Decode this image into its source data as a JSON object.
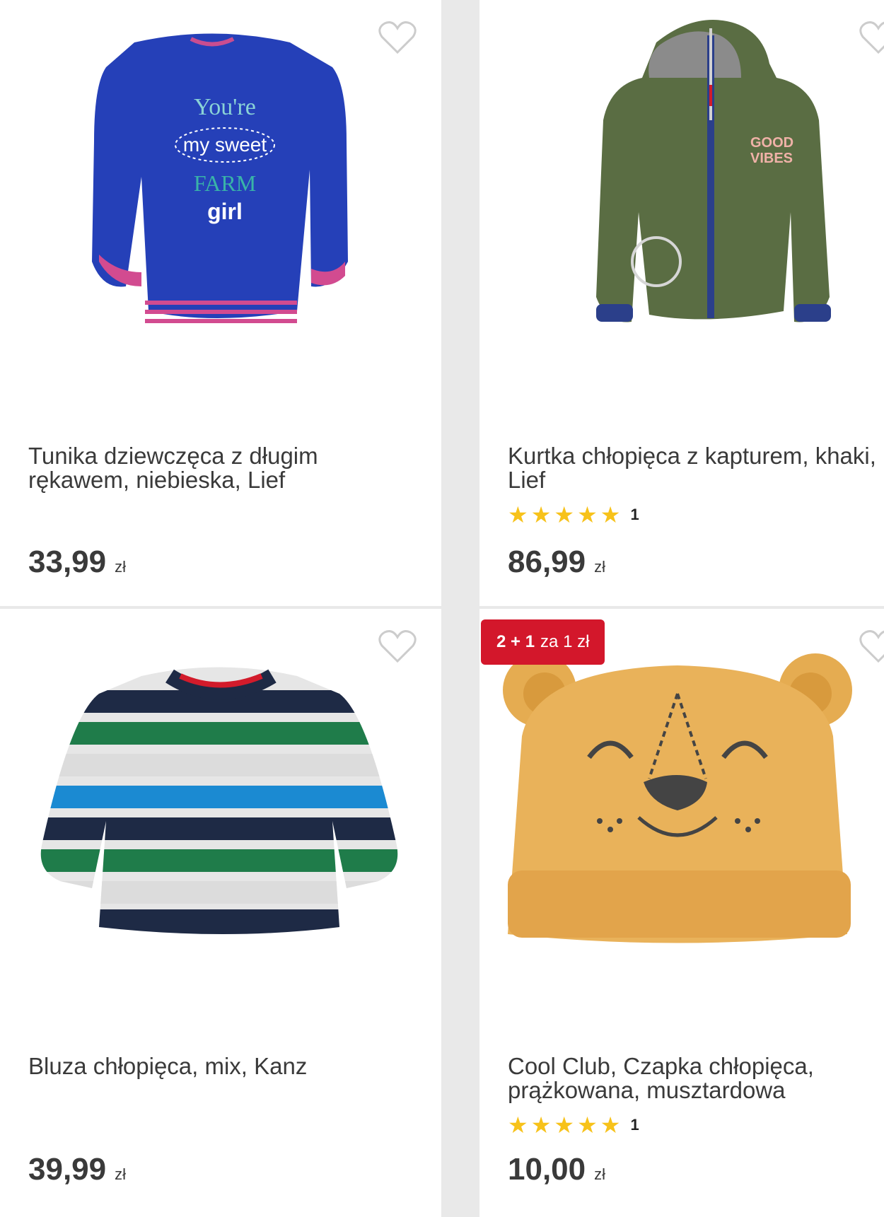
{
  "products": [
    {
      "title": "Tunika dziewczęca z długim rękawem, niebieska, Lief",
      "price": "33,99",
      "currency": "zł",
      "image_text": [
        "You're",
        "my sweet",
        "FARM",
        "girl"
      ]
    },
    {
      "title": "Kurtka chłopięca z kapturem, khaki, Lief",
      "rating_count": "1",
      "price": "86,99",
      "currency": "zł",
      "image_text": [
        "GOOD",
        "VIBES"
      ]
    },
    {
      "title": "Bluza chłopięca, mix, Kanz",
      "price": "39,99",
      "currency": "zł"
    },
    {
      "title": "Cool Club, Czapka chłopięca, prążkowana, musztardowa",
      "rating_count": "1",
      "price": "10,00",
      "currency": "zł",
      "badge_bold": "2 + 1",
      "badge_text": "za 1 zł"
    }
  ],
  "colors": {
    "star": "#f7c21a",
    "badge": "#d3172b",
    "heart": "#cccccc"
  },
  "icons": {
    "favorite": "heart-outline-icon",
    "star": "star-icon"
  }
}
